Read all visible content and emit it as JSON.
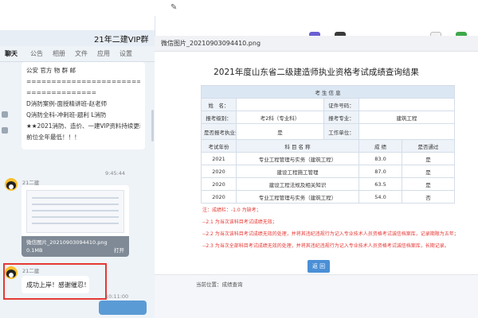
{
  "chat": {
    "title": "21年二建VIP群",
    "tabs": [
      "聊天",
      "公告",
      "相册",
      "文件",
      "应用",
      "设置"
    ],
    "notice_lines": [
      "公安 官方 物 群 邮",
      "========================2021【消防VI",
      "==============",
      "D消防案例-面授精讲班-赵老师",
      "Q消防全科-冲刺班-题利                L消防",
      "★★2021消防、造价、一建VIP资料持续更新",
      "前位全年最低！！！"
    ],
    "time_1": "9:45:44",
    "sender_1": "21二建",
    "image_caption": "微信图片_20210903094410.png",
    "image_size": "0.1MB",
    "image_action": "打开",
    "sender_2": "21二建",
    "reply_text": "成功上岸！感谢催忍！",
    "time_2": "10:11:00"
  },
  "viewer": {
    "file_title": "微信图片_20210903094410.png",
    "doc_title": "2021年度山东省二级建造师执业资格考试成绩查询结果",
    "section_header": "考 生 信 息",
    "info": {
      "name_label": "姓　名：",
      "id_label": "证件号码：",
      "level_label": "报考级别：",
      "level_value": "考2科（专业科）",
      "major_label": "报考专业：",
      "major_value": "建筑工程",
      "exempt_label": "是否报考执业资格：",
      "exempt_value": "是",
      "work_label": "工作单位："
    },
    "columns": [
      "考试年份",
      "科 目 名 称",
      "成 绩",
      "是否通过"
    ],
    "rows": [
      {
        "year": "2021",
        "subject": "专业工程管理与实务（建筑工程）",
        "score": "83.0",
        "pass": "是"
      },
      {
        "year": "2020",
        "subject": "建设工程施工管理",
        "score": "87.0",
        "pass": "是"
      },
      {
        "year": "2020",
        "subject": "建设工程法规及相关知识",
        "score": "63.5",
        "pass": "是"
      },
      {
        "year": "2020",
        "subject": "专业工程管理与实务（建筑工程）",
        "score": "54.0",
        "pass": "否"
      }
    ],
    "notes": [
      "注：成绩栏：-1.0 为缺考；",
      "--2.1 为当次该科目考试成绩无效；",
      "--2.2 为当次该科目考试成绩无效的处理，并将其违纪违规行为记入专业技术人员资格考试诚信档案库，记录期限为五年；",
      "--2.3 为当次全部科目考试成绩无效的处理，并将其违纪违规行为记入专业技术人员资格考试诚信档案库，长期记录。"
    ],
    "return_label": "返 回",
    "footer_text": "当前位置：成绩查询"
  },
  "colors": {
    "accent_blue": "#4a8fd6",
    "highlight_red": "#e53935",
    "table_header": "#dbe7f3"
  },
  "icons": [
    "pen-icon",
    "taskbar-app-icon",
    "user-avatar-icon",
    "image-file-icon"
  ]
}
